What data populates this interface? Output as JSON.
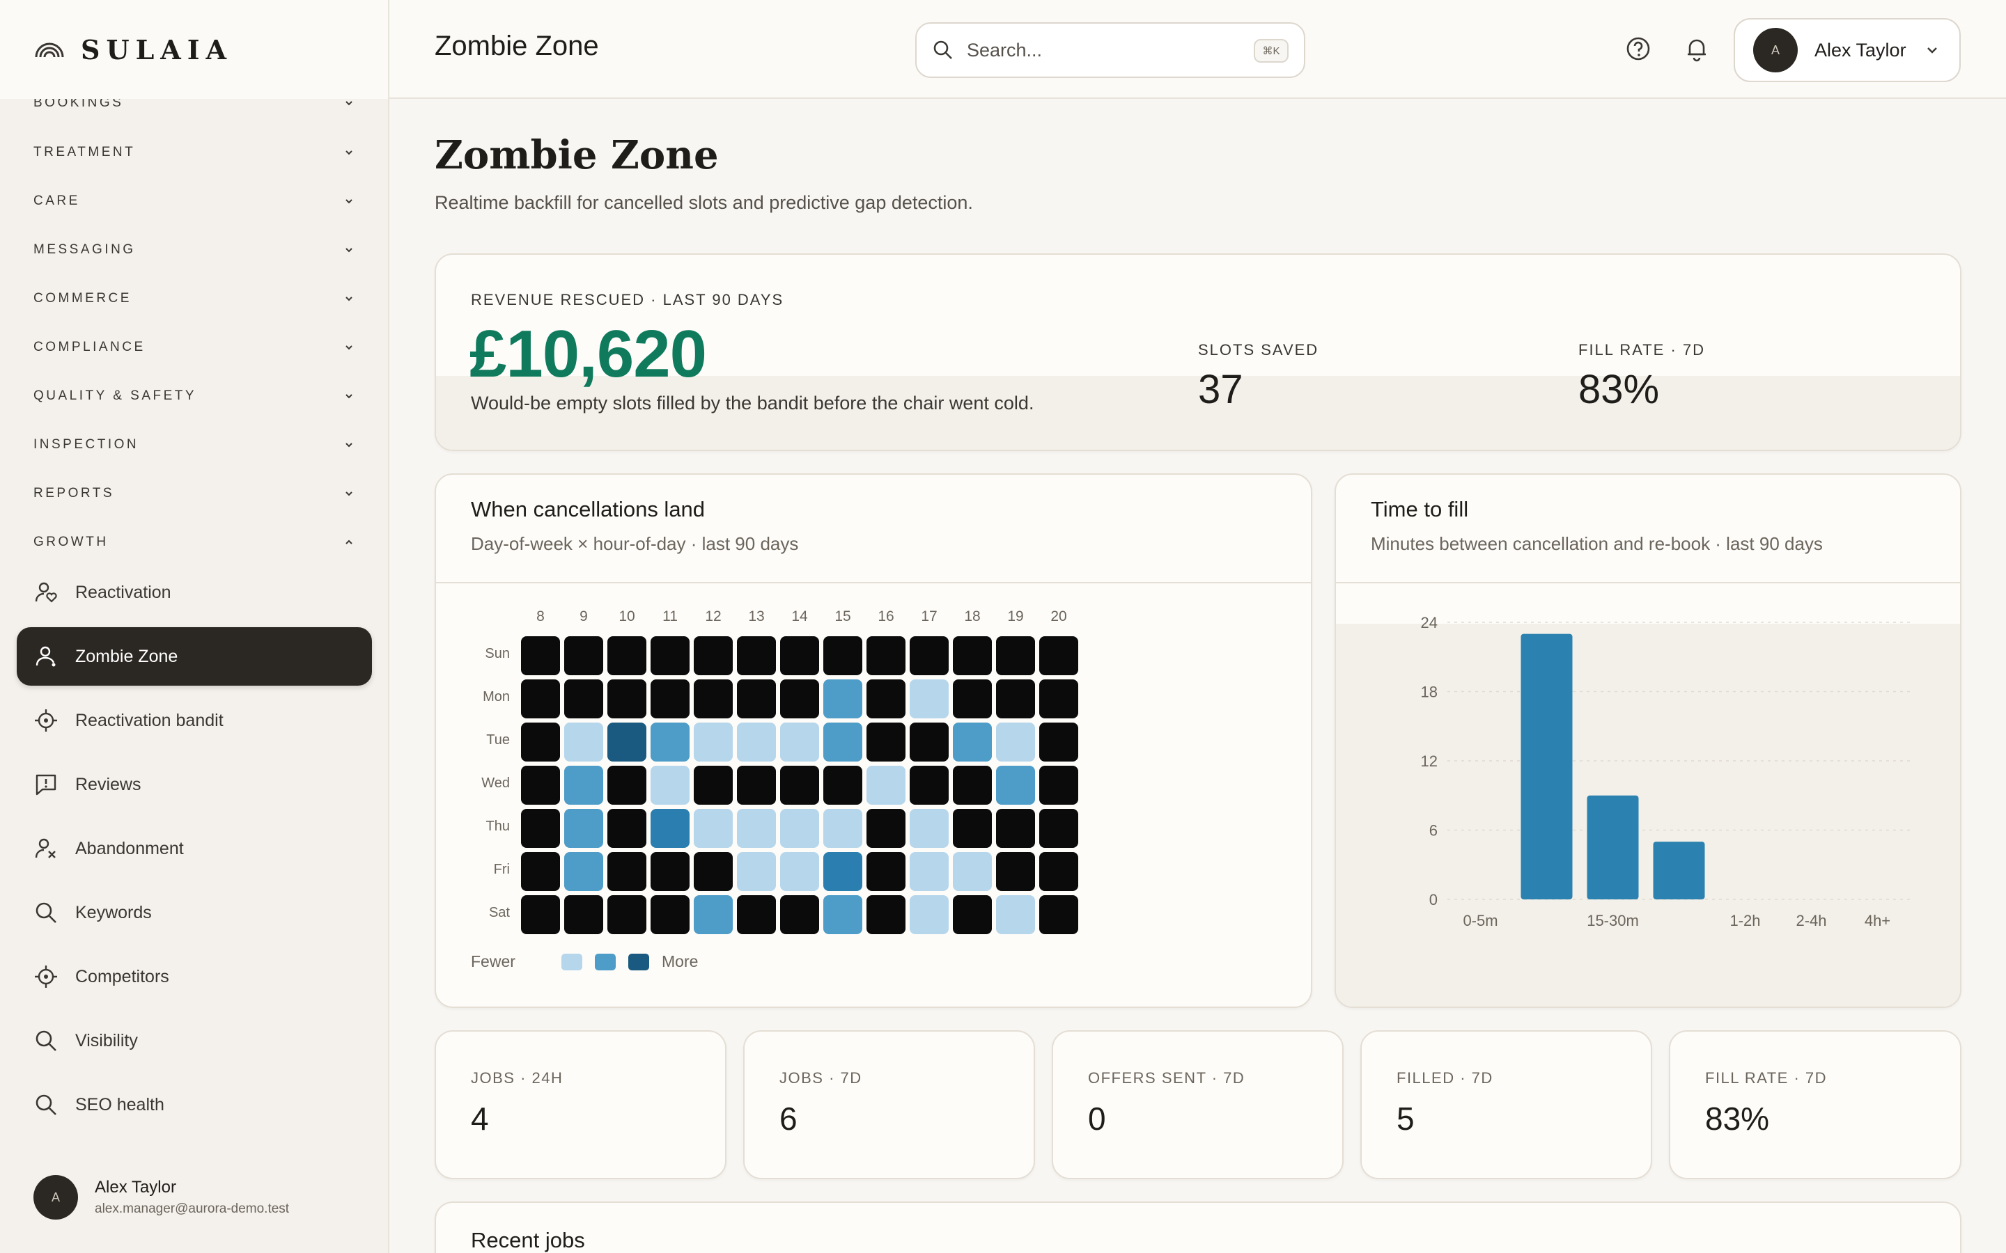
{
  "brand": {
    "name": "SULAIA"
  },
  "sidebar": {
    "sections": [
      {
        "label": "BOOKINGS"
      },
      {
        "label": "TREATMENT"
      },
      {
        "label": "CARE"
      },
      {
        "label": "MESSAGING"
      },
      {
        "label": "COMMERCE"
      },
      {
        "label": "COMPLIANCE"
      },
      {
        "label": "QUALITY & SAFETY"
      },
      {
        "label": "INSPECTION"
      },
      {
        "label": "REPORTS"
      },
      {
        "label": "GROWTH"
      }
    ],
    "items": [
      {
        "label": "Reactivation",
        "icon": "user-heart-icon"
      },
      {
        "label": "Zombie Zone",
        "icon": "user-icon",
        "active": true
      },
      {
        "label": "Reactivation bandit",
        "icon": "target-icon"
      },
      {
        "label": "Reviews",
        "icon": "message-alert-icon"
      },
      {
        "label": "Abandonment",
        "icon": "user-x-icon"
      },
      {
        "label": "Keywords",
        "icon": "search-icon"
      },
      {
        "label": "Competitors",
        "icon": "target-icon"
      },
      {
        "label": "Visibility",
        "icon": "search-icon"
      },
      {
        "label": "SEO health",
        "icon": "search-icon"
      }
    ],
    "user": {
      "initial": "A",
      "name": "Alex Taylor",
      "email": "alex.manager@aurora-demo.test"
    }
  },
  "topbar": {
    "title": "Zombie Zone",
    "search_placeholder": "Search...",
    "shortcut": "⌘K",
    "user_initial": "A",
    "user_name": "Alex Taylor"
  },
  "page": {
    "title": "Zombie Zone",
    "subtitle": "Realtime backfill for cancelled slots and predictive gap detection."
  },
  "hero": {
    "label": "REVENUE RESCUED · LAST 90 DAYS",
    "value": "£10,620",
    "desc": "Would-be empty slots filled by the bandit before the chair went cold.",
    "slots_label": "SLOTS SAVED",
    "slots_value": "37",
    "fill_label": "FILL RATE · 7D",
    "fill_value": "83%",
    "accent": "#0f7a5c"
  },
  "heatmap": {
    "title": "When cancellations land",
    "subtitle": "Day-of-week × hour-of-day · last 90 days",
    "hours": [
      "8",
      "9",
      "10",
      "11",
      "12",
      "13",
      "14",
      "15",
      "16",
      "17",
      "18",
      "19",
      "20"
    ],
    "days": [
      "Sun",
      "Mon",
      "Tue",
      "Wed",
      "Thu",
      "Fri",
      "Sat"
    ],
    "grid": [
      [
        0,
        0,
        0,
        0,
        0,
        0,
        0,
        0,
        0,
        0,
        0,
        0,
        0
      ],
      [
        0,
        0,
        0,
        0,
        0,
        0,
        0,
        2,
        0,
        1,
        0,
        0,
        0
      ],
      [
        0,
        1,
        4,
        2,
        1,
        1,
        1,
        2,
        0,
        0,
        2,
        1,
        0
      ],
      [
        0,
        2,
        0,
        1,
        0,
        0,
        0,
        0,
        1,
        0,
        0,
        2,
        0
      ],
      [
        0,
        2,
        0,
        3,
        1,
        1,
        1,
        1,
        0,
        1,
        0,
        0,
        0
      ],
      [
        0,
        2,
        0,
        0,
        0,
        1,
        1,
        3,
        0,
        1,
        1,
        0,
        0
      ],
      [
        0,
        0,
        0,
        0,
        2,
        0,
        0,
        2,
        0,
        1,
        0,
        1,
        0
      ]
    ],
    "colors": [
      "#0b0b0b",
      "#b6d6ec",
      "#4e9cc8",
      "#2a7fb0",
      "#1b5a80"
    ],
    "legend_fewer": "Fewer",
    "legend_more": "More"
  },
  "chart_data": {
    "type": "bar",
    "title": "Time to fill",
    "subtitle": "Minutes between cancellation and re-book · last 90 days",
    "categories": [
      "0-5m",
      "5-15m",
      "15-30m",
      "30-60m",
      "1-2h",
      "2-4h",
      "4h+"
    ],
    "visible_tick_labels": [
      "0-5m",
      "15-30m",
      "1-2h",
      "2-4h",
      "4h+"
    ],
    "values": [
      0,
      23,
      9,
      5,
      0,
      0,
      0
    ],
    "yticks": [
      "0",
      "6",
      "12",
      "18",
      "24"
    ],
    "ylim": [
      0,
      24
    ],
    "color": "#2b82b0",
    "grid": true
  },
  "stats": [
    {
      "label": "JOBS · 24H",
      "value": "4"
    },
    {
      "label": "JOBS · 7D",
      "value": "6"
    },
    {
      "label": "OFFERS SENT · 7D",
      "value": "0"
    },
    {
      "label": "FILLED · 7D",
      "value": "5"
    },
    {
      "label": "FILL RATE · 7D",
      "value": "83%"
    }
  ],
  "recent": {
    "title": "Recent jobs"
  }
}
